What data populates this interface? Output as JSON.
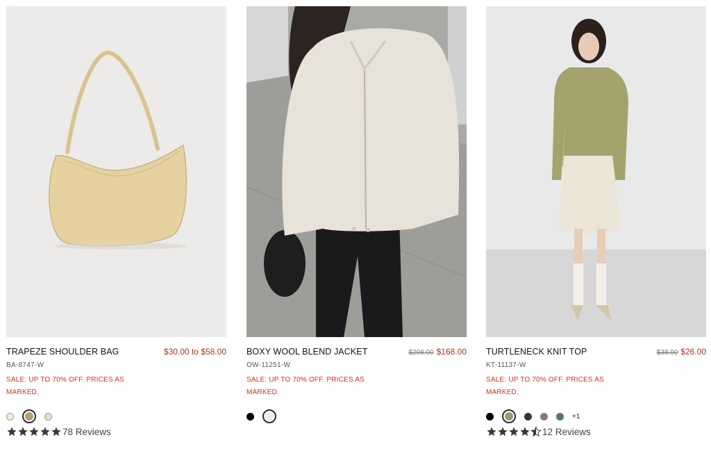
{
  "products": [
    {
      "name": "TRAPEZE SHOULDER BAG",
      "price_range": "$30.00 to $58.00",
      "sku": "BA-8747-W",
      "promo": "SALE: UP TO 70% OFF. PRICES AS MARKED.",
      "swatches": [
        "#f4ecd6",
        "#b79f74",
        "#f1ddc6"
      ],
      "selected_swatch": 1,
      "rating": 5,
      "reviews": "78 Reviews"
    },
    {
      "name": "BOXY WOOL BLEND JACKET",
      "original_price": "$208.00",
      "sale_price": "$168.00",
      "sku": "OW-11251-W",
      "promo": "SALE: UP TO 70% OFF. PRICES AS MARKED.",
      "swatches": [
        "#000000",
        "#f1ece3"
      ],
      "selected_swatch": 1
    },
    {
      "name": "TURTLENECK KNIT TOP",
      "original_price": "$38.00",
      "sale_price": "$26.00",
      "sku": "KT-11137-W",
      "promo": "SALE: UP TO 70% OFF. PRICES AS MARKED.",
      "swatches": [
        "#000000",
        "#9c9a6e",
        "#3a3531",
        "#807d7a",
        "#4f7a6c"
      ],
      "selected_swatch": 1,
      "more_colors": "+1",
      "rating": 4.5,
      "reviews": "12 Reviews"
    }
  ],
  "colors": {
    "price_red": "#b0301e",
    "promo_red": "#d6311c",
    "star": "#3a3a3a"
  }
}
